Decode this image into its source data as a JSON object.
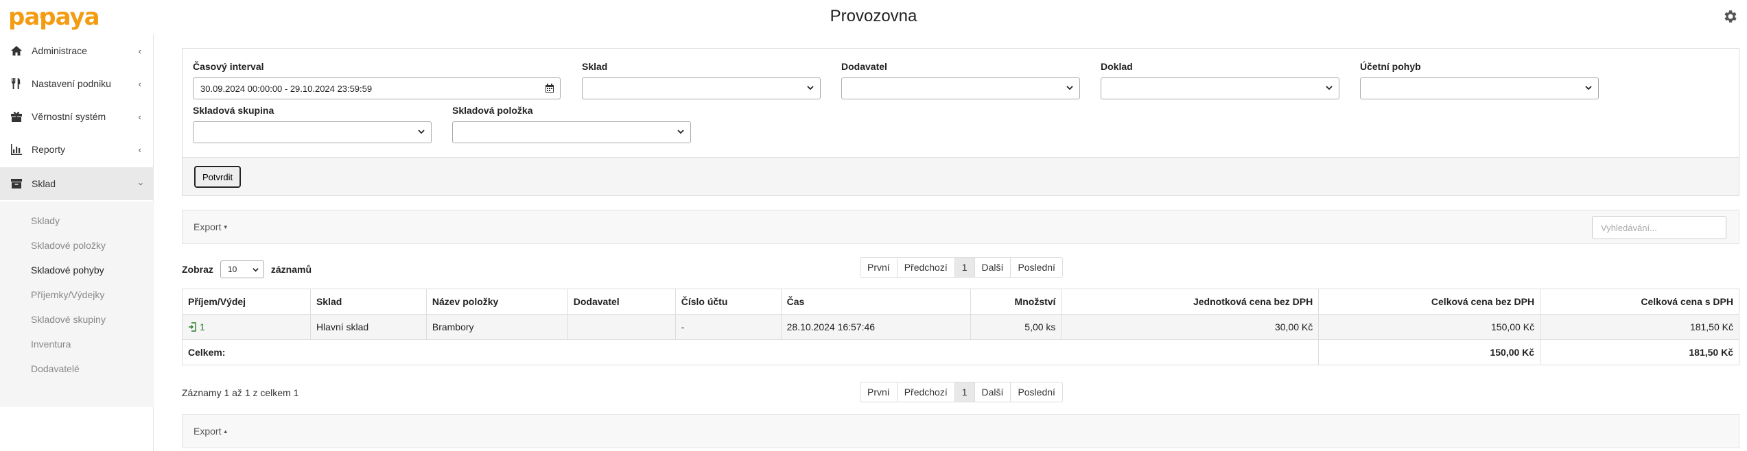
{
  "app": {
    "logo": "papaya",
    "title": "Provozovna",
    "brand_color": "#f39c12"
  },
  "sidebar": {
    "items": [
      {
        "label": "Administrace",
        "icon": "home-icon"
      },
      {
        "label": "Nastavení podniku",
        "icon": "cutlery-icon"
      },
      {
        "label": "Věrnostní systém",
        "icon": "gift-icon"
      },
      {
        "label": "Reporty",
        "icon": "bar-chart-icon"
      },
      {
        "label": "Sklad",
        "icon": "archive-box-icon"
      }
    ],
    "submenu": [
      "Sklady",
      "Skladové položky",
      "Skladové pohyby",
      "Příjemky/Výdejky",
      "Skladové skupiny",
      "Inventura",
      "Dodavatelé"
    ]
  },
  "filters": {
    "interval_label": "Časový interval",
    "interval_value": "30.09.2024 00:00:00 - 29.10.2024 23:59:59",
    "sklad_label": "Sklad",
    "dodavatel_label": "Dodavatel",
    "doklad_label": "Doklad",
    "ucetni_pohyb_label": "Účetní pohyb",
    "skladova_skupina_label": "Skladová skupina",
    "skladova_polozka_label": "Skladová položka",
    "confirm_label": "Potvrdit"
  },
  "toolbar": {
    "export_label": "Export",
    "search_placeholder": "Vyhledávání..."
  },
  "length": {
    "prefix": "Zobraz",
    "value": "10",
    "suffix": "záznamů"
  },
  "pagination": {
    "first": "První",
    "prev": "Předchozí",
    "current": "1",
    "next": "Další",
    "last": "Poslední"
  },
  "table": {
    "columns": [
      "Příjem/Výdej",
      "Sklad",
      "Název položky",
      "Dodavatel",
      "Číslo účtu",
      "Čas",
      "Množství",
      "Jednotková cena bez DPH",
      "Celková cena bez DPH",
      "Celková cena s DPH"
    ],
    "rows": [
      {
        "id": "1",
        "sklad": "Hlavní sklad",
        "nazev": "Brambory",
        "dodavatel": "",
        "cislo_uctu": "-",
        "cas": "28.10.2024 16:57:46",
        "mnozstvi": "5,00 ks",
        "jednotkova": "30,00 Kč",
        "celkova_bez": "150,00 Kč",
        "celkova_s": "181,50 Kč"
      }
    ],
    "footer": {
      "label": "Celkem:",
      "celkova_bez": "150,00 Kč",
      "celkova_s": "181,50 Kč"
    }
  },
  "info": "Záznamy 1 až 1 z celkem 1"
}
